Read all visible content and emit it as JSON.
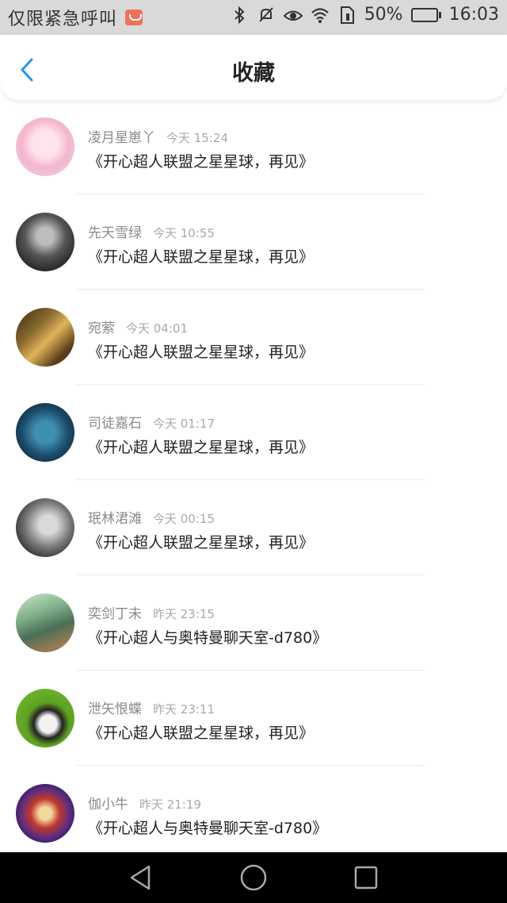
{
  "status_bar": {
    "carrier": "仅限紧急呼叫",
    "battery_percent": "50%",
    "battery_level": 0.5,
    "time": "16:03",
    "icons": [
      "mail-icon",
      "bluetooth-icon",
      "mute-icon",
      "eye-icon",
      "wifi-icon",
      "sim-icon",
      "battery-icon"
    ]
  },
  "header": {
    "title": "收藏",
    "back_icon": "chevron-left-icon",
    "accent_color": "#2196f3"
  },
  "favorites": [
    {
      "name": "凌月星崽丫",
      "time": "今天 15:24",
      "title": "《开心超人联盟之星星球，再见》"
    },
    {
      "name": "先天雪绿",
      "time": "今天 10:55",
      "title": "《开心超人联盟之星星球，再见》"
    },
    {
      "name": "宛萦",
      "time": "今天 04:01",
      "title": "《开心超人联盟之星星球，再见》"
    },
    {
      "name": "司徒嘉石",
      "time": "今天 01:17",
      "title": "《开心超人联盟之星星球，再见》"
    },
    {
      "name": "珉林涒滩",
      "time": "今天 00:15",
      "title": "《开心超人联盟之星星球，再见》"
    },
    {
      "name": "奕剑丁未",
      "time": "昨天 23:15",
      "title": "《开心超人与奥特曼聊天室-d780》"
    },
    {
      "name": "泄矢恨蝶",
      "time": "昨天 23:11",
      "title": "《开心超人联盟之星星球，再见》"
    },
    {
      "name": "伽小牛",
      "time": "昨天 21:19",
      "title": "《开心超人与奥特曼聊天室-d780》"
    }
  ],
  "nav_bar": {
    "icons": [
      "back-triangle-icon",
      "home-circle-icon",
      "recents-square-icon"
    ]
  }
}
